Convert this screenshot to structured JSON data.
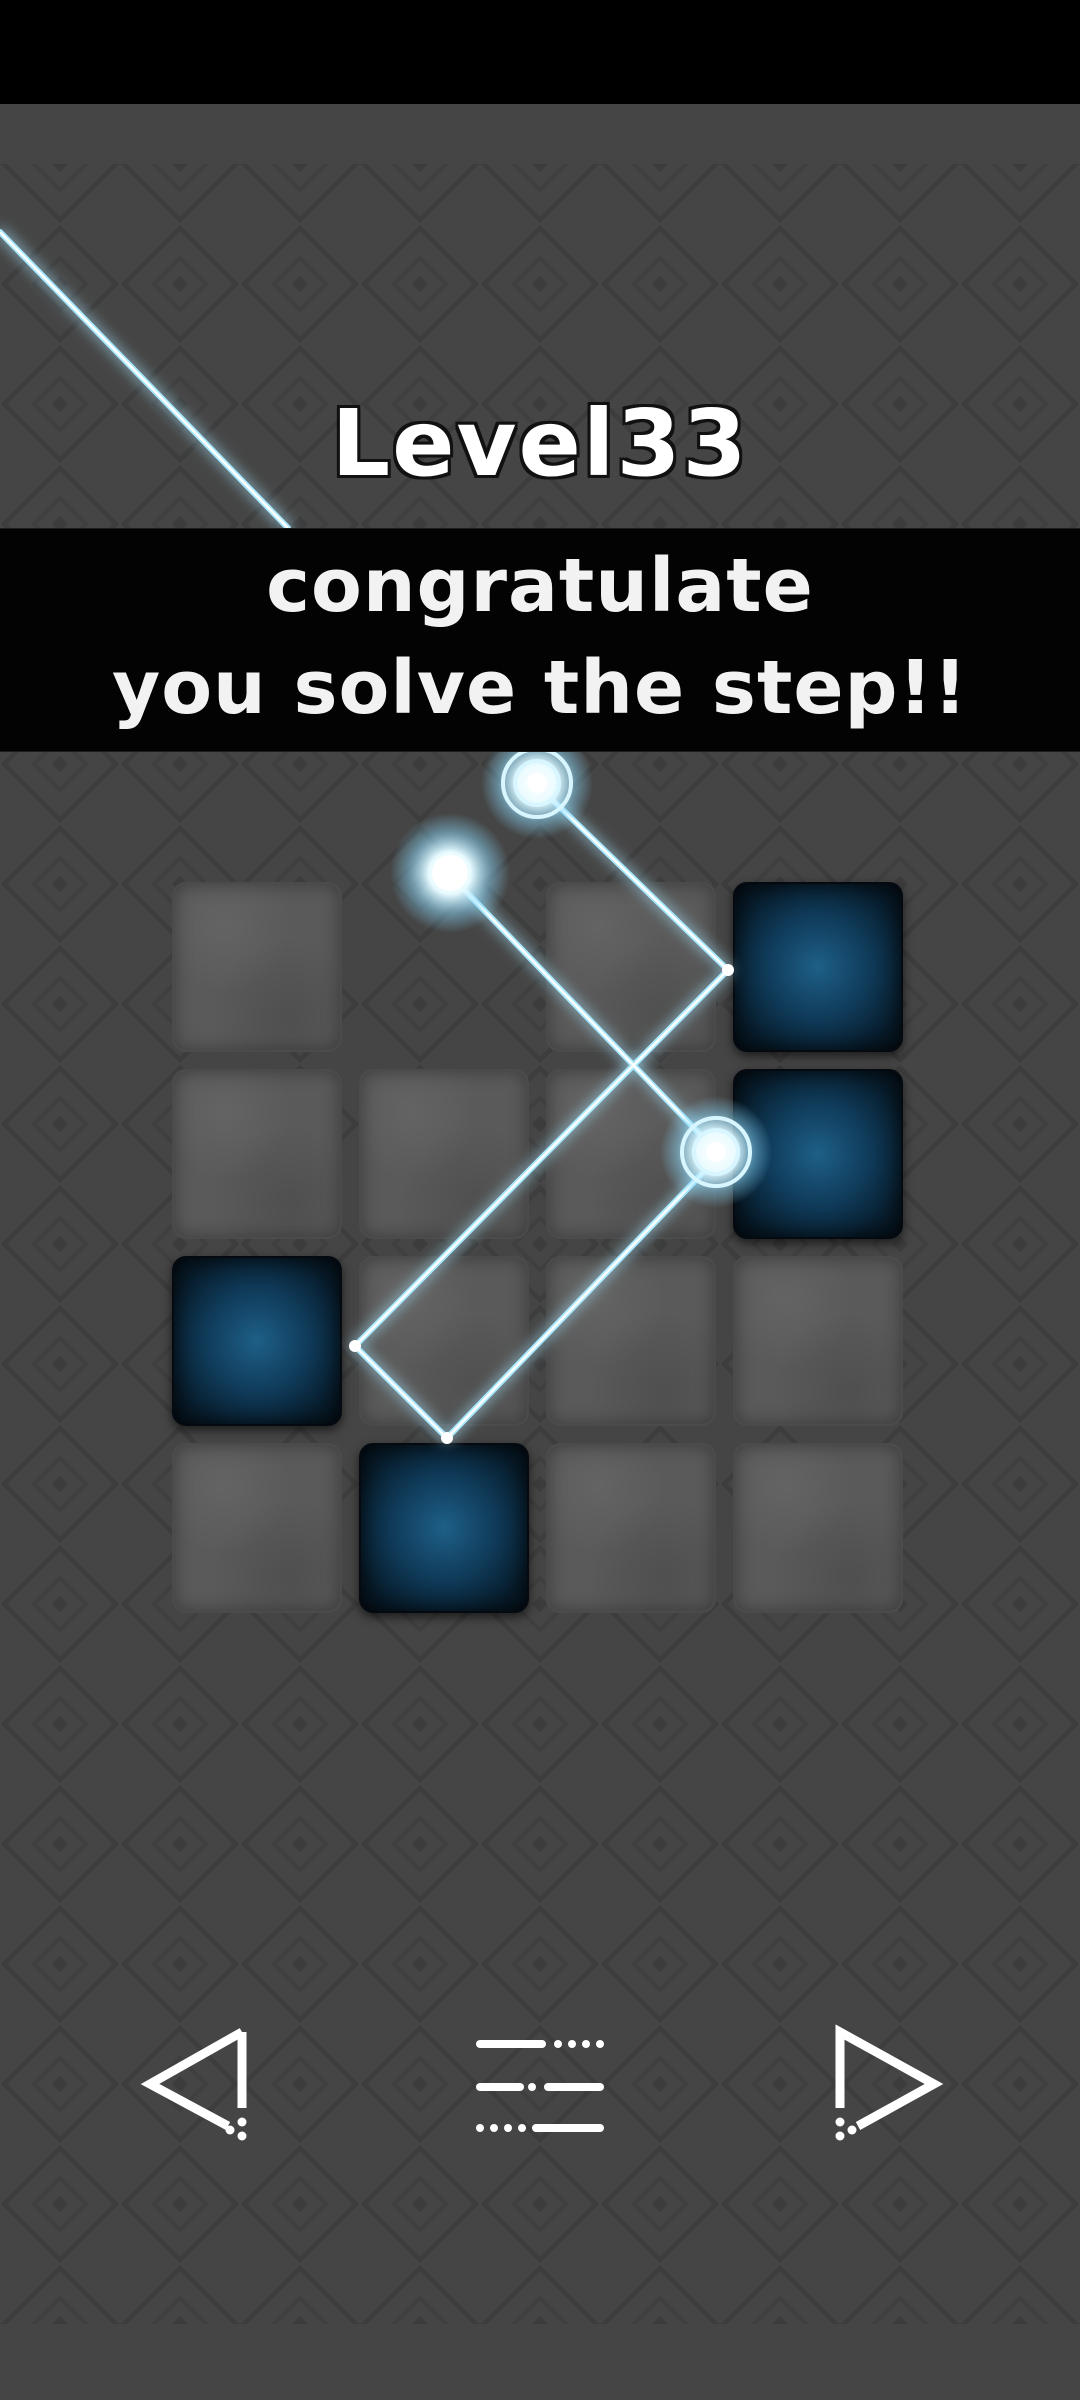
{
  "level": {
    "title": "Level33"
  },
  "banner": {
    "line1": "congratulate",
    "line2": "you solve the step!!"
  },
  "board": {
    "rows": 4,
    "cols": 4,
    "tiles": [
      [
        "stone",
        "empty",
        "stone",
        "mirror"
      ],
      [
        "stone",
        "stone",
        "stone",
        "mirror"
      ],
      [
        "mirror",
        "stone",
        "stone",
        "stone"
      ],
      [
        "stone",
        "mirror",
        "stone",
        "stone"
      ]
    ]
  },
  "colors": {
    "background": "#454545",
    "beam": "#a9e8ff",
    "mirror_tile": "#0f3a58",
    "stone_tile": "#5a5a5a"
  },
  "navigation": {
    "prev_icon": "triangle-left-icon",
    "menu_icon": "level-menu-icon",
    "next_icon": "triangle-right-icon"
  }
}
